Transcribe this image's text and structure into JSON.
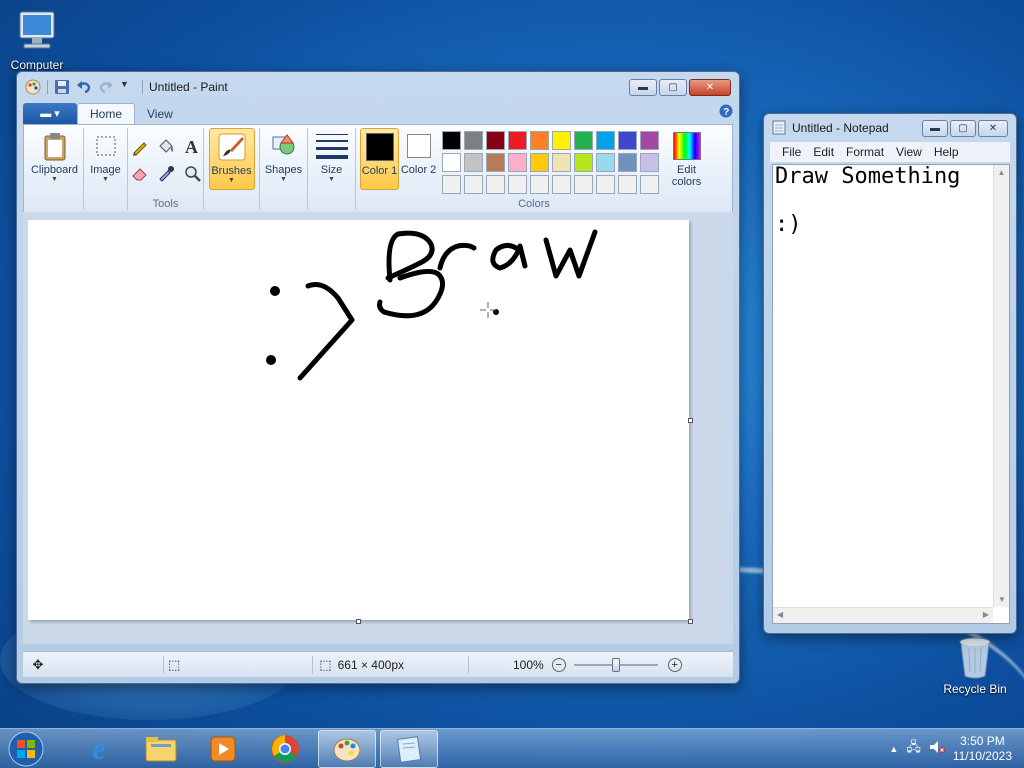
{
  "desktop": {
    "icons": [
      {
        "label": "Computer"
      },
      {
        "label": "Recycle Bin"
      }
    ]
  },
  "paint": {
    "title": "Untitled - Paint",
    "tabs": {
      "home": "Home",
      "view": "View"
    },
    "groups": {
      "clipboard": "Clipboard",
      "image": "Image",
      "tools": "Tools",
      "brushes": "Brushes",
      "shapes": "Shapes",
      "size": "Size",
      "color1": "Color 1",
      "color2": "Color 2",
      "colors": "Colors",
      "edit_colors": "Edit colors"
    },
    "palette": [
      "#000000",
      "#7f7f7f",
      "#880015",
      "#ed1c24",
      "#ff7f27",
      "#fff200",
      "#22b14c",
      "#00a2e8",
      "#3f48cc",
      "#a349a4",
      "#ffffff",
      "#c3c3c3",
      "#b97a57",
      "#ffaec9",
      "#ffc90e",
      "#efe4b0",
      "#b5e61d",
      "#99d9ea",
      "#7092be",
      "#c8bfe7",
      "#f0f0f0",
      "#f0f0f0",
      "#f0f0f0",
      "#f0f0f0",
      "#f0f0f0",
      "#f0f0f0",
      "#f0f0f0",
      "#f0f0f0",
      "#f0f0f0",
      "#f0f0f0"
    ],
    "color1": "#000000",
    "color2": "#ffffff",
    "status": {
      "canvas_size": "661 × 400px",
      "zoom": "100%"
    }
  },
  "notepad": {
    "title": "Untitled - Notepad",
    "menu": [
      "File",
      "Edit",
      "Format",
      "View",
      "Help"
    ],
    "content": "Draw Something\n\n:)"
  },
  "taskbar": {
    "time": "3:50 PM",
    "date": "11/10/2023"
  }
}
